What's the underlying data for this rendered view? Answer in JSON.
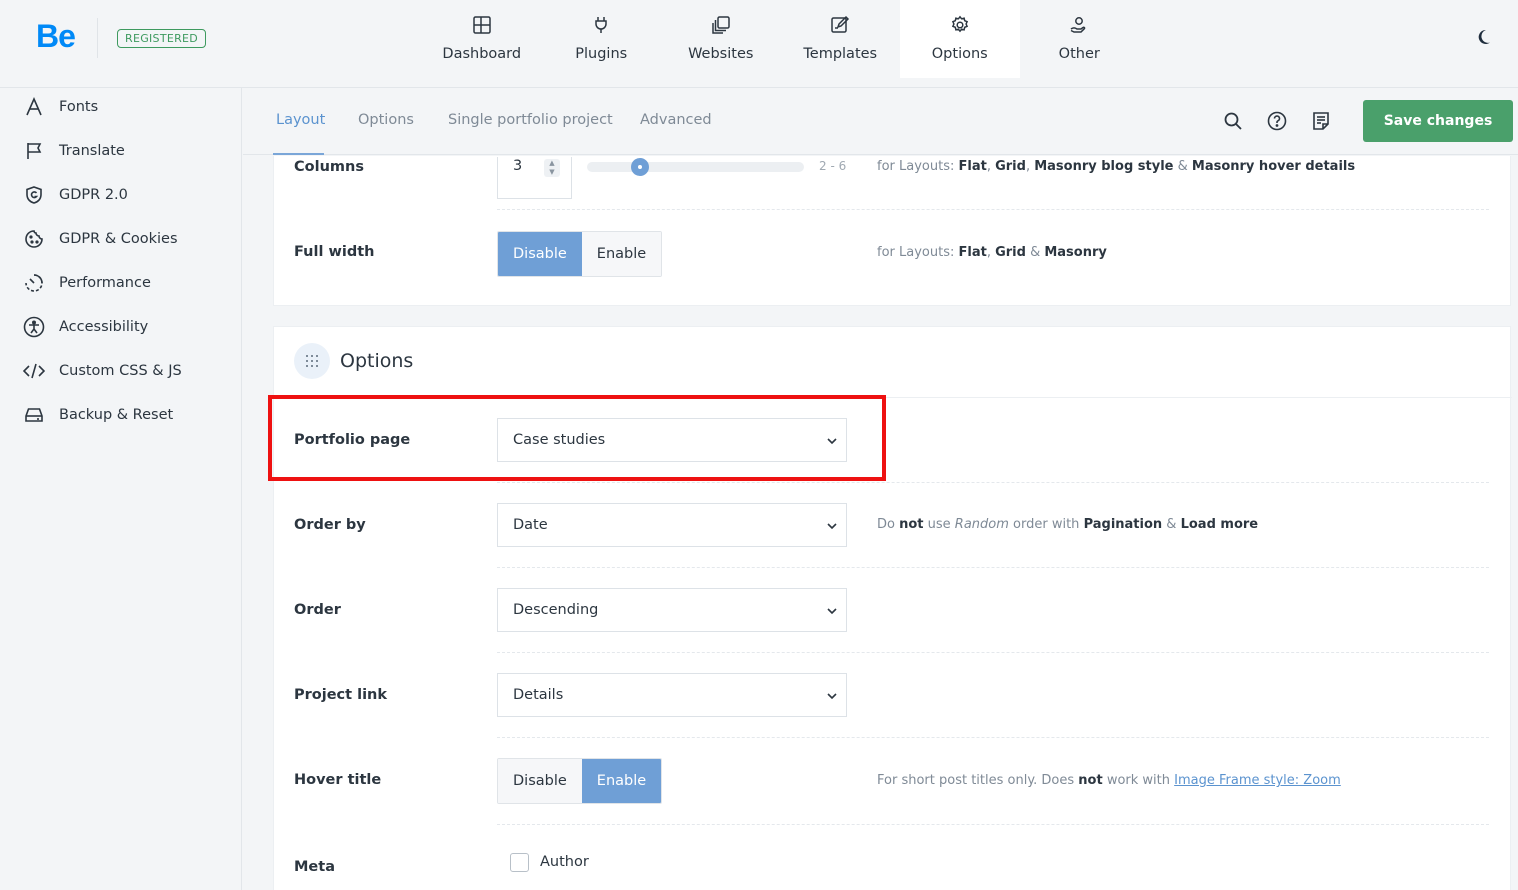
{
  "app": {
    "logo": "Be",
    "badge": "REGISTERED"
  },
  "top_nav": [
    {
      "label": "Dashboard",
      "icon": "dashboard-icon"
    },
    {
      "label": "Plugins",
      "icon": "plug-icon"
    },
    {
      "label": "Websites",
      "icon": "websites-icon"
    },
    {
      "label": "Templates",
      "icon": "templates-icon"
    },
    {
      "label": "Options",
      "icon": "gear-icon",
      "active": true
    },
    {
      "label": "Other",
      "icon": "hand-user-icon"
    }
  ],
  "sidebar": [
    {
      "label": "Fonts",
      "icon": "font-icon"
    },
    {
      "label": "Translate",
      "icon": "flag-icon"
    },
    {
      "label": "GDPR 2.0",
      "icon": "shield-icon"
    },
    {
      "label": "GDPR & Cookies",
      "icon": "cookie-icon"
    },
    {
      "label": "Performance",
      "icon": "speed-icon"
    },
    {
      "label": "Accessibility",
      "icon": "accessibility-icon"
    },
    {
      "label": "Custom CSS & JS",
      "icon": "code-icon"
    },
    {
      "label": "Backup & Reset",
      "icon": "drive-icon"
    }
  ],
  "sub_tabs": [
    {
      "label": "Layout",
      "active": true
    },
    {
      "label": "Options"
    },
    {
      "label": "Single portfolio project"
    },
    {
      "label": "Advanced"
    }
  ],
  "toolbar": {
    "save_label": "Save changes"
  },
  "layout_card": {
    "columns": {
      "label": "Columns",
      "value": "3",
      "range": "2 - 6",
      "slider_value": 3,
      "slider_min": 2,
      "slider_max": 6
    },
    "columns_hint": {
      "prefix": "for Layouts: ",
      "flat": "Flat",
      "c1": ", ",
      "grid": "Grid",
      "c2": ", ",
      "masonry_blog": "Masonry blog style",
      "amp": " & ",
      "masonry_hover": "Masonry hover details"
    },
    "full_width": {
      "label": "Full width",
      "off": "Disable",
      "on": "Enable",
      "selected": "Disable"
    },
    "full_width_hint": {
      "prefix": "for Layouts: ",
      "flat": "Flat",
      "c1": ", ",
      "grid": "Grid",
      "amp": " & ",
      "masonry": "Masonry"
    }
  },
  "options_card": {
    "title": "Options",
    "portfolio_page": {
      "label": "Portfolio page",
      "value": "Case studies"
    },
    "order_by": {
      "label": "Order by",
      "value": "Date"
    },
    "order_by_hint": {
      "t1": "Do ",
      "b1": "not",
      "t2": " use ",
      "i1": "Random",
      "t3": " order with ",
      "b2": "Pagination",
      "t4": " & ",
      "b3": "Load more"
    },
    "order": {
      "label": "Order",
      "value": "Descending"
    },
    "project_link": {
      "label": "Project link",
      "value": "Details"
    },
    "hover_title": {
      "label": "Hover title",
      "off": "Disable",
      "on": "Enable",
      "selected": "Enable"
    },
    "hover_hint": {
      "t1": "For short post titles only. Does ",
      "b1": "not",
      "t2": " work with ",
      "link": "Image Frame style: Zoom"
    },
    "meta": {
      "label": "Meta",
      "author_label": "Author",
      "author_checked": false
    }
  },
  "colors": {
    "brand": "#0089f7",
    "accent": "#6f9fd6",
    "save": "#4aa06b",
    "highlight": "#ee1111"
  }
}
